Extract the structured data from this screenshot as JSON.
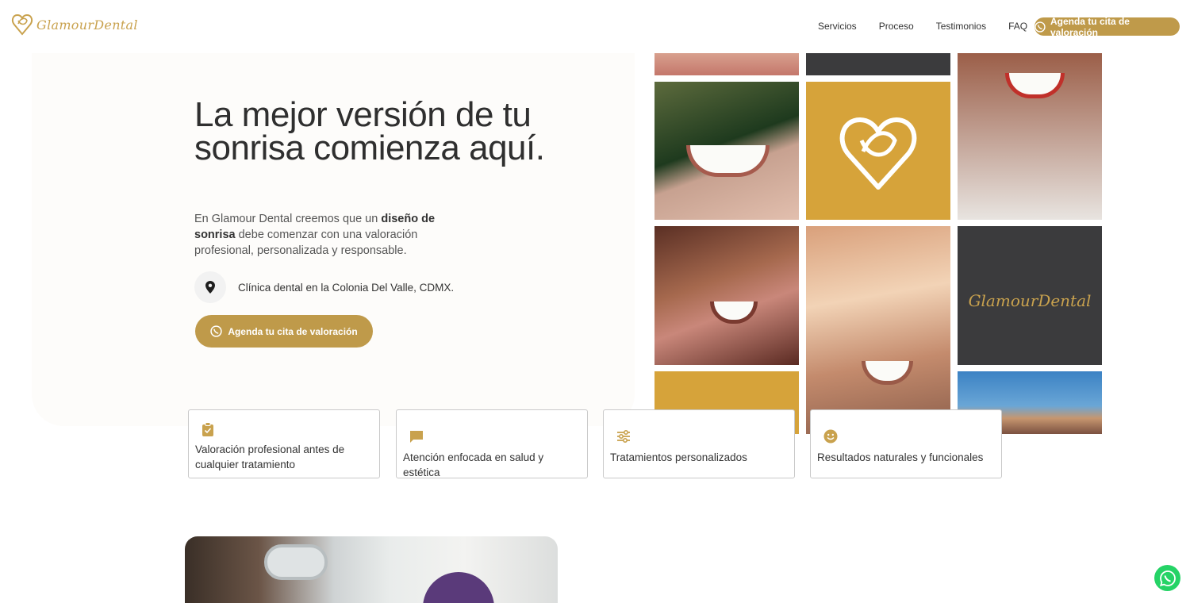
{
  "header": {
    "logo_text": "GlamourDental",
    "nav": [
      "Servicios",
      "Proceso",
      "Testimonios",
      "FAQ"
    ],
    "cta_label": "Agenda tu cita de valoración"
  },
  "hero": {
    "title": "La mejor versión de tu sonrisa comienza aquí.",
    "intro_before": "En Glamour Dental creemos que un ",
    "intro_bold": "diseño de sonrisa",
    "intro_after": " debe comenzar con una valoración profesional, personalizada y responsable.",
    "location": "Clínica dental en la Colonia Del Valle, CDMX.",
    "cta_label": "Agenda tu cita de valoración"
  },
  "mosaic": {
    "logo_tile_text": "GlamourDental"
  },
  "features": [
    {
      "icon": "clipboard-check-icon",
      "text": "Valoración profesional antes de cualquier tratamiento"
    },
    {
      "icon": "chat-bubble-icon",
      "text": "Atención enfocada en salud y estética"
    },
    {
      "icon": "sliders-icon",
      "text": "Tratamientos personalizados"
    },
    {
      "icon": "smile-icon",
      "text": "Resultados naturales y funcionales"
    }
  ],
  "colors": {
    "accent_gold": "#bf9a4a",
    "tile_gold": "#d6a33a",
    "tile_dark": "#3b3b3d",
    "whatsapp": "#25d366"
  }
}
